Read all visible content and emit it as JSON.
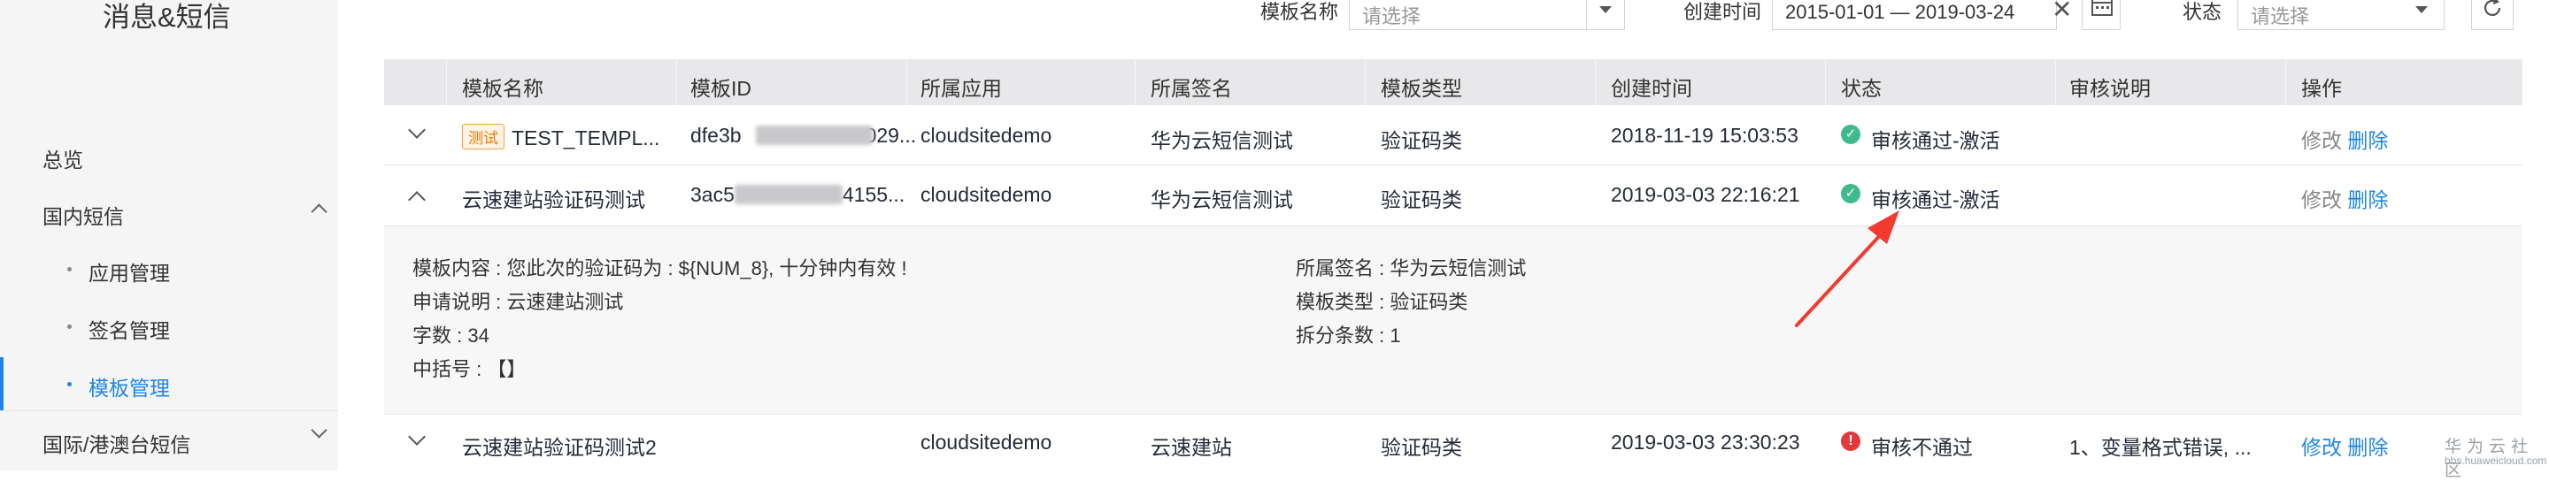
{
  "sidebar": {
    "title": "消息&短信",
    "overview": "总览",
    "domestic": "国内短信",
    "sub_items": [
      "应用管理",
      "签名管理",
      "模板管理"
    ],
    "international": "国际/港澳台短信"
  },
  "filters": {
    "template_name_label": "模板名称",
    "template_name_placeholder": "请选择",
    "created_label": "创建时间",
    "date_range": "2015-01-01 — 2019-03-24",
    "status_label": "状态",
    "status_placeholder": "请选择"
  },
  "table": {
    "headers": [
      "模板名称",
      "模板ID",
      "所属应用",
      "所属签名",
      "模板类型",
      "创建时间",
      "状态",
      "审核说明",
      "操作"
    ],
    "rows": [
      {
        "badge": "测试",
        "name": "TEST_TEMPL...",
        "id_prefix": "dfe3b",
        "id_suffix": "029...",
        "app": "cloudsitedemo",
        "sign": "华为云短信测试",
        "type": "验证码类",
        "created": "2018-11-19 15:03:53",
        "status": "审核通过-激活",
        "note": "",
        "edit": "修改",
        "delete": "删除"
      },
      {
        "name": "云速建站验证码测试",
        "id_prefix": "3ac5",
        "id_suffix": "4155...",
        "app": "cloudsitedemo",
        "sign": "华为云短信测试",
        "type": "验证码类",
        "created": "2019-03-03 22:16:21",
        "status": "审核通过-激活",
        "note": "",
        "edit": "修改",
        "delete": "删除"
      },
      {
        "name": "云速建站验证码测试2",
        "id_prefix": "",
        "id_suffix": "",
        "app": "cloudsitedemo",
        "sign": "云速建站",
        "type": "验证码类",
        "created": "2019-03-03 23:30:23",
        "status": "审核不通过",
        "note": "1、变量格式错误, ...",
        "edit": "修改",
        "delete": "删除"
      }
    ]
  },
  "detail": {
    "content": "模板内容 : 您此次的验证码为 : ${NUM_8}, 十分钟内有效 !",
    "apply_note": "申请说明 : 云速建站测试",
    "char_count": "字数 : 34",
    "bracket": "中括号 : 【】",
    "signature": "所属签名 : 华为云短信测试",
    "template_type": "模板类型 : 验证码类",
    "split_count": "拆分条数 : 1"
  },
  "watermark": {
    "line1": "华为云社区",
    "line2": "bbs.huaweicloud.com"
  },
  "colors": {
    "link": "#1f86e6",
    "success": "#3fba8b",
    "error": "#e4393c",
    "annotation_arrow": "#f23a2f"
  }
}
